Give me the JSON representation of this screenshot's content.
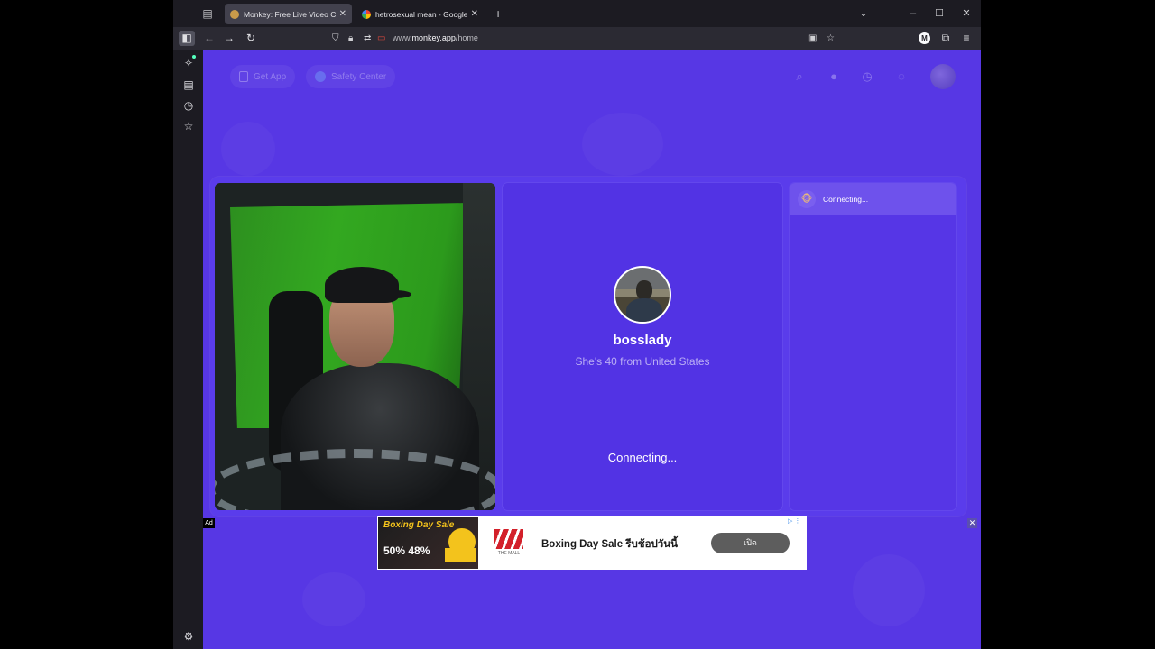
{
  "browser": {
    "tabs": [
      {
        "label": "Monkey: Free Live Video Chat ti",
        "active": true
      },
      {
        "label": "hetrosexual mean - Google Sea",
        "active": false
      }
    ],
    "url": {
      "prefix": "www.",
      "domain": "monkey.app",
      "path": "/home"
    },
    "extension_badge": "M"
  },
  "site_header": {
    "get_app": "Get App",
    "safety_center": "Safety Center"
  },
  "chat": {
    "match": {
      "name": "bosslady",
      "subtitle": "She's 40 from United States",
      "status": "Connecting..."
    },
    "messages": [
      {
        "icon": "monkey-icon",
        "text": "Connecting..."
      }
    ]
  },
  "ad": {
    "label": "Ad",
    "image_title": "Boxing Day Sale",
    "image_discount": "50% 48%",
    "logo_text": "THE MALL",
    "headline": "Boxing Day Sale รีบช้อปวันนี้",
    "cta": "เปิด",
    "choices": "▷ ⋮",
    "close": "✕"
  },
  "colors": {
    "page_bg": "#5737e4",
    "panel_bg": "#5233e4",
    "chat_highlight": "#6e52ec",
    "browser_chrome": "#1c1b22"
  }
}
